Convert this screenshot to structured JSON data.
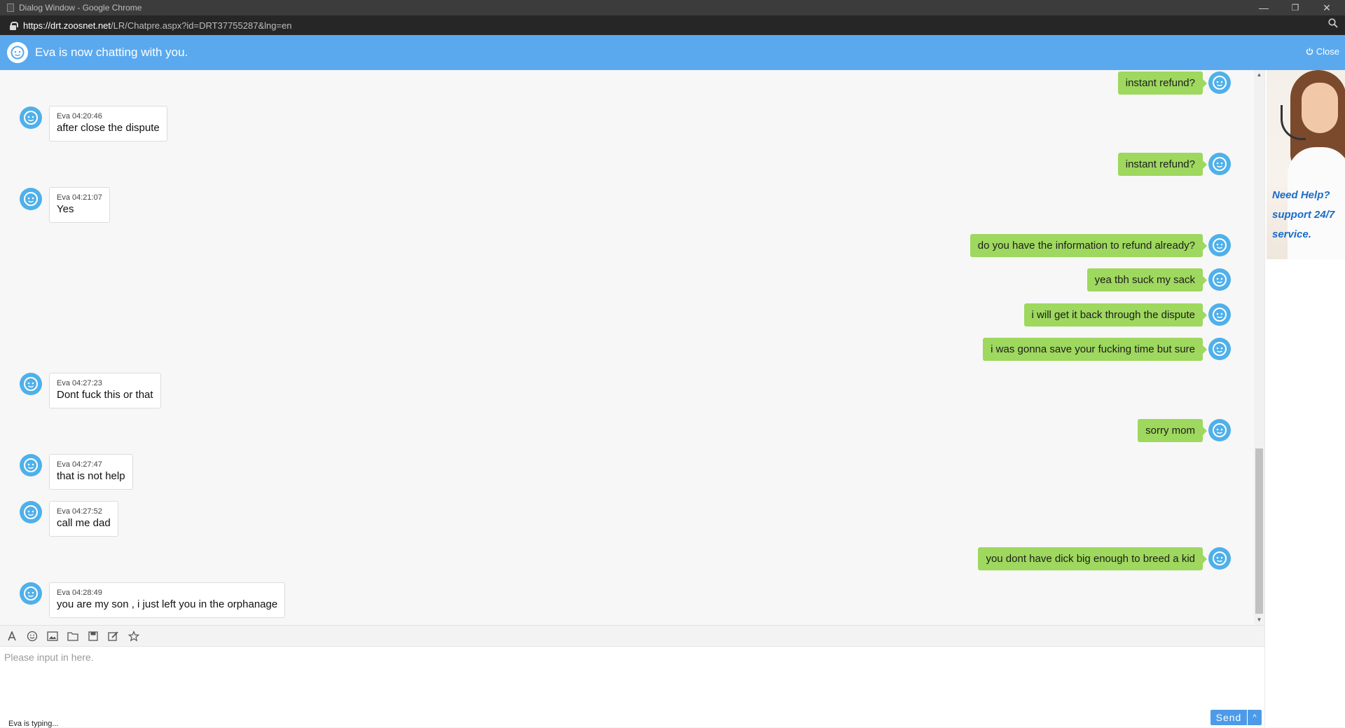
{
  "window": {
    "title": "Dialog Window - Google Chrome",
    "minimize": "—",
    "restore": "❐",
    "close": "✕"
  },
  "address": {
    "host": "https://drt.zoosnet.net",
    "path": "/LR/Chatpre.aspx?id=DRT37755287&lng=en"
  },
  "header": {
    "title": "Eva is now chatting with you.",
    "close_label": "Close"
  },
  "messages": [
    {
      "side": "user",
      "text": "instant refund?"
    },
    {
      "side": "agent",
      "meta": "Eva 04:20:46",
      "text": "after close the dispute"
    },
    {
      "side": "user",
      "text": "instant refund?"
    },
    {
      "side": "agent",
      "meta": "Eva 04:21:07",
      "text": "Yes"
    },
    {
      "side": "user",
      "text": "do you have the information to refund already?"
    },
    {
      "side": "user",
      "text": "yea tbh suck my sack"
    },
    {
      "side": "user",
      "text": "i will get it back through the dispute"
    },
    {
      "side": "user",
      "text": "i was gonna save your fucking time but sure"
    },
    {
      "side": "agent",
      "meta": "Eva 04:27:23",
      "text": "Dont fuck this or that"
    },
    {
      "side": "user",
      "text": "sorry mom"
    },
    {
      "side": "agent",
      "meta": "Eva 04:27:47",
      "text": "that is not help"
    },
    {
      "side": "agent",
      "meta": "Eva 04:27:52",
      "text": "call me dad"
    },
    {
      "side": "user",
      "text": "you dont have dick big enough to breed a kid"
    },
    {
      "side": "agent",
      "meta": "Eva 04:28:49",
      "text": "you are my son , i just left you in the orphanage"
    }
  ],
  "toolbar": {
    "icons": [
      "font-icon",
      "emoji-icon",
      "image-icon",
      "folder-icon",
      "save-icon",
      "edit-icon",
      "star-icon"
    ]
  },
  "input": {
    "placeholder": "Please input in here.",
    "value": "",
    "typing_status": "Eva is typing...",
    "send_label": "Send",
    "send_more": "^"
  },
  "banner": {
    "line1": "Need Help?",
    "line2": "support 24/7",
    "line3": "service."
  },
  "colors": {
    "header": "#5aa9ef",
    "user_bubble": "#9ed85e",
    "avatar": "#4fb0ea",
    "send_button": "#4d9be8"
  }
}
